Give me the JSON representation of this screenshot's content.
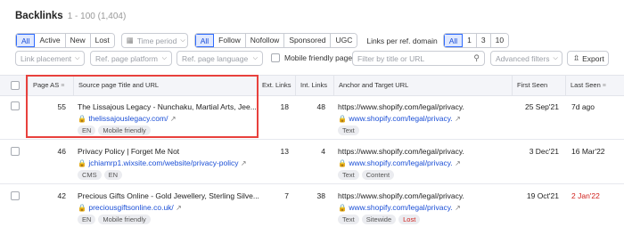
{
  "header": {
    "title": "Backlinks",
    "subtitle": "1 - 100 (1,404)"
  },
  "filters": {
    "type_group": [
      "All",
      "Active",
      "New",
      "Lost"
    ],
    "time_period_placeholder": "Time period",
    "follow_group": [
      "All",
      "Follow",
      "Nofollow",
      "Sponsored",
      "UGC"
    ],
    "links_per_domain_label": "Links per ref. domain",
    "links_per_domain_group": [
      "All",
      "1",
      "3",
      "10"
    ],
    "link_placement": "Link placement",
    "ref_page_platform": "Ref. page platform",
    "ref_page_language": "Ref. page language",
    "mobile_friendly_label": "Mobile friendly pages",
    "search_placeholder": "Filter by title or URL",
    "advanced_filters": "Advanced filters",
    "export_label": "Export"
  },
  "table": {
    "columns": [
      "Page AS",
      "Source page Title and URL",
      "Ext. Links",
      "Int. Links",
      "Anchor and Target URL",
      "First Seen",
      "Last Seen"
    ],
    "rows": [
      {
        "page_as": "55",
        "title": "The Lissajous Legacy - Nunchaku, Martial Arts, Jee...",
        "url": "thelissajouslegacy.com/",
        "tags": [
          "EN",
          "Mobile friendly"
        ],
        "ext_links": "18",
        "int_links": "48",
        "anchor": "https://www.shopify.com/legal/privacy.",
        "target": "www.shopify.com/legal/privacy.",
        "anchor_tags": [
          "Text"
        ],
        "first_seen": "25 Sep'21",
        "last_seen": "7d ago",
        "last_seen_red": false
      },
      {
        "page_as": "46",
        "title": "Privacy Policy | Forget Me Not",
        "url": "jchiamrp1.wixsite.com/website/privacy-policy",
        "tags": [
          "CMS",
          "EN"
        ],
        "ext_links": "13",
        "int_links": "4",
        "anchor": "https://www.shopify.com/legal/privacy.",
        "target": "www.shopify.com/legal/privacy.",
        "anchor_tags": [
          "Text",
          "Content"
        ],
        "first_seen": "3 Dec'21",
        "last_seen": "16 Mar'22",
        "last_seen_red": false
      },
      {
        "page_as": "42",
        "title": "Precious Gifts Online - Gold Jewellery, Sterling Silve...",
        "url": "preciousgiftsonline.co.uk/",
        "tags": [
          "EN",
          "Mobile friendly"
        ],
        "ext_links": "7",
        "int_links": "38",
        "anchor": "https://www.shopify.com/legal/privacy.",
        "target": "www.shopify.com/legal/privacy.",
        "anchor_tags": [
          "Text",
          "Sitewide",
          "Lost"
        ],
        "first_seen": "19 Oct'21",
        "last_seen": "2 Jan'22",
        "last_seen_red": true
      }
    ]
  },
  "colors": {
    "accent": "#1b4fd6",
    "highlight_border": "#e8413d",
    "lost_red": "#d0211c"
  }
}
